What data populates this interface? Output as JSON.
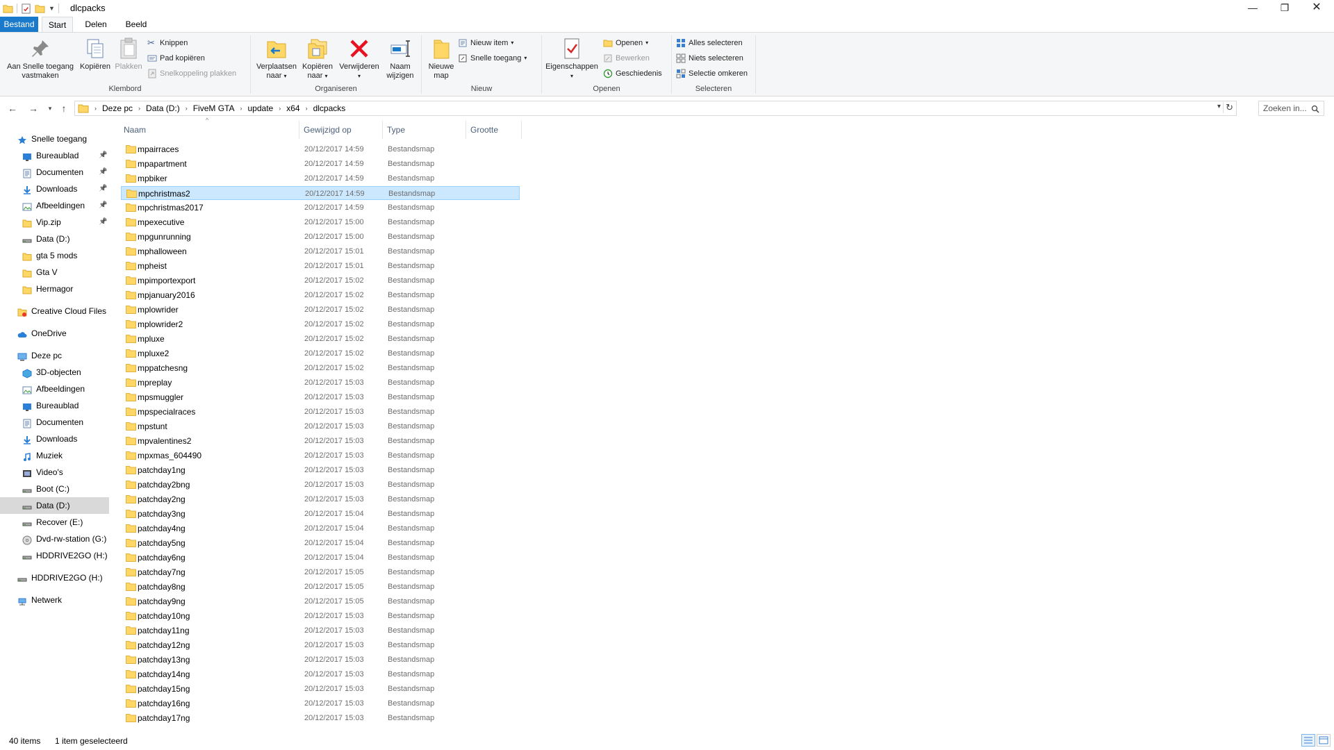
{
  "window": {
    "title": "dlcpacks",
    "minimize_icon": "minimize-icon",
    "maximize_icon": "restore-icon",
    "close_icon": "close-icon"
  },
  "ribbon_tabs": {
    "file": "Bestand",
    "start": "Start",
    "share": "Delen",
    "view": "Beeld"
  },
  "ribbon": {
    "clipboard": {
      "label": "Klembord",
      "pin": "Aan Snelle toegang vastmaken",
      "copy": "Kopiëren",
      "paste": "Plakken",
      "cut": "Knippen",
      "copy_path": "Pad kopiëren",
      "paste_shortcut": "Snelkoppeling plakken"
    },
    "organize": {
      "label": "Organiseren",
      "move_to": "Verplaatsen naar",
      "copy_to": "Kopiëren naar",
      "delete": "Verwijderen",
      "rename": "Naam wijzigen"
    },
    "new": {
      "label": "Nieuw",
      "new_folder": "Nieuwe map",
      "new_item": "Nieuw item",
      "easy_access": "Snelle toegang"
    },
    "open": {
      "label": "Openen",
      "properties": "Eigenschappen",
      "open": "Openen",
      "edit": "Bewerken",
      "history": "Geschiedenis"
    },
    "select": {
      "label": "Selecteren",
      "select_all": "Alles selecteren",
      "select_none": "Niets selecteren",
      "invert": "Selectie omkeren"
    }
  },
  "address": {
    "crumbs": [
      "Deze pc",
      "Data (D:)",
      "FiveM GTA",
      "update",
      "x64",
      "dlcpacks"
    ],
    "search_placeholder": "Zoeken in..."
  },
  "nav": {
    "quick_access": "Snelle toegang",
    "quick_items": [
      "Bureaublad",
      "Documenten",
      "Downloads",
      "Afbeeldingen",
      "Vip.zip",
      "Data (D:)",
      "gta 5 mods",
      "Gta V",
      "Hermagor"
    ],
    "creative_cloud": "Creative Cloud Files",
    "onedrive": "OneDrive",
    "this_pc": "Deze pc",
    "pc_items": [
      "3D-objecten",
      "Afbeeldingen",
      "Bureaublad",
      "Documenten",
      "Downloads",
      "Muziek",
      "Video's",
      "Boot (C:)",
      "Data (D:)",
      "Recover (E:)",
      "Dvd-rw-station (G:)",
      "HDDRIVE2GO (H:)"
    ],
    "hddrive": "HDDRIVE2GO (H:)",
    "network": "Netwerk"
  },
  "columns": {
    "name": "Naam",
    "modified": "Gewijzigd op",
    "type": "Type",
    "size": "Grootte"
  },
  "files": [
    {
      "name": "mpairraces",
      "date": "20/12/2017 14:59",
      "type": "Bestandsmap"
    },
    {
      "name": "mpapartment",
      "date": "20/12/2017 14:59",
      "type": "Bestandsmap"
    },
    {
      "name": "mpbiker",
      "date": "20/12/2017 14:59",
      "type": "Bestandsmap"
    },
    {
      "name": "mpchristmas2",
      "date": "20/12/2017 14:59",
      "type": "Bestandsmap"
    },
    {
      "name": "mpchristmas2017",
      "date": "20/12/2017 14:59",
      "type": "Bestandsmap"
    },
    {
      "name": "mpexecutive",
      "date": "20/12/2017 15:00",
      "type": "Bestandsmap"
    },
    {
      "name": "mpgunrunning",
      "date": "20/12/2017 15:00",
      "type": "Bestandsmap"
    },
    {
      "name": "mphalloween",
      "date": "20/12/2017 15:01",
      "type": "Bestandsmap"
    },
    {
      "name": "mpheist",
      "date": "20/12/2017 15:01",
      "type": "Bestandsmap"
    },
    {
      "name": "mpimportexport",
      "date": "20/12/2017 15:02",
      "type": "Bestandsmap"
    },
    {
      "name": "mpjanuary2016",
      "date": "20/12/2017 15:02",
      "type": "Bestandsmap"
    },
    {
      "name": "mplowrider",
      "date": "20/12/2017 15:02",
      "type": "Bestandsmap"
    },
    {
      "name": "mplowrider2",
      "date": "20/12/2017 15:02",
      "type": "Bestandsmap"
    },
    {
      "name": "mpluxe",
      "date": "20/12/2017 15:02",
      "type": "Bestandsmap"
    },
    {
      "name": "mpluxe2",
      "date": "20/12/2017 15:02",
      "type": "Bestandsmap"
    },
    {
      "name": "mppatchesng",
      "date": "20/12/2017 15:02",
      "type": "Bestandsmap"
    },
    {
      "name": "mpreplay",
      "date": "20/12/2017 15:03",
      "type": "Bestandsmap"
    },
    {
      "name": "mpsmuggler",
      "date": "20/12/2017 15:03",
      "type": "Bestandsmap"
    },
    {
      "name": "mpspecialraces",
      "date": "20/12/2017 15:03",
      "type": "Bestandsmap"
    },
    {
      "name": "mpstunt",
      "date": "20/12/2017 15:03",
      "type": "Bestandsmap"
    },
    {
      "name": "mpvalentines2",
      "date": "20/12/2017 15:03",
      "type": "Bestandsmap"
    },
    {
      "name": "mpxmas_604490",
      "date": "20/12/2017 15:03",
      "type": "Bestandsmap"
    },
    {
      "name": "patchday1ng",
      "date": "20/12/2017 15:03",
      "type": "Bestandsmap"
    },
    {
      "name": "patchday2bng",
      "date": "20/12/2017 15:03",
      "type": "Bestandsmap"
    },
    {
      "name": "patchday2ng",
      "date": "20/12/2017 15:03",
      "type": "Bestandsmap"
    },
    {
      "name": "patchday3ng",
      "date": "20/12/2017 15:04",
      "type": "Bestandsmap"
    },
    {
      "name": "patchday4ng",
      "date": "20/12/2017 15:04",
      "type": "Bestandsmap"
    },
    {
      "name": "patchday5ng",
      "date": "20/12/2017 15:04",
      "type": "Bestandsmap"
    },
    {
      "name": "patchday6ng",
      "date": "20/12/2017 15:04",
      "type": "Bestandsmap"
    },
    {
      "name": "patchday7ng",
      "date": "20/12/2017 15:05",
      "type": "Bestandsmap"
    },
    {
      "name": "patchday8ng",
      "date": "20/12/2017 15:05",
      "type": "Bestandsmap"
    },
    {
      "name": "patchday9ng",
      "date": "20/12/2017 15:05",
      "type": "Bestandsmap"
    },
    {
      "name": "patchday10ng",
      "date": "20/12/2017 15:03",
      "type": "Bestandsmap"
    },
    {
      "name": "patchday11ng",
      "date": "20/12/2017 15:03",
      "type": "Bestandsmap"
    },
    {
      "name": "patchday12ng",
      "date": "20/12/2017 15:03",
      "type": "Bestandsmap"
    },
    {
      "name": "patchday13ng",
      "date": "20/12/2017 15:03",
      "type": "Bestandsmap"
    },
    {
      "name": "patchday14ng",
      "date": "20/12/2017 15:03",
      "type": "Bestandsmap"
    },
    {
      "name": "patchday15ng",
      "date": "20/12/2017 15:03",
      "type": "Bestandsmap"
    },
    {
      "name": "patchday16ng",
      "date": "20/12/2017 15:03",
      "type": "Bestandsmap"
    },
    {
      "name": "patchday17ng",
      "date": "20/12/2017 15:03",
      "type": "Bestandsmap"
    }
  ],
  "selected_file": "mpchristmas2",
  "status": {
    "count": "40 items",
    "selected": "1 item geselecteerd"
  },
  "colors": {
    "accent": "#1979ca",
    "selection": "#cce8ff",
    "folder": "#ffd767",
    "delete_red": "#e81123"
  }
}
